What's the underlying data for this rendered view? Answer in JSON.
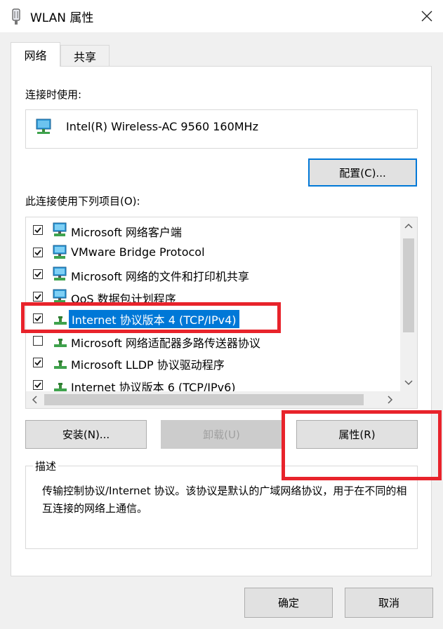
{
  "window": {
    "title": "WLAN 属性"
  },
  "tabs": [
    {
      "label": "网络"
    },
    {
      "label": "共享"
    }
  ],
  "connect_using": {
    "label": "连接时使用:",
    "adapter_name": "Intel(R) Wireless-AC 9560 160MHz",
    "configure_label": "配置(C)..."
  },
  "items_section": {
    "label": "此连接使用下列项目(O):",
    "items": [
      {
        "label": "Microsoft 网络客户端",
        "checked": true,
        "icon": "network-client-icon"
      },
      {
        "label": "VMware Bridge Protocol",
        "checked": true,
        "icon": "network-client-icon"
      },
      {
        "label": "Microsoft 网络的文件和打印机共享",
        "checked": true,
        "icon": "network-client-icon"
      },
      {
        "label": "QoS 数据包计划程序",
        "checked": true,
        "icon": "network-client-icon"
      },
      {
        "label": "Internet 协议版本 4 (TCP/IPv4)",
        "checked": true,
        "icon": "protocol-icon",
        "selected": true
      },
      {
        "label": "Microsoft 网络适配器多路传送器协议",
        "checked": false,
        "icon": "protocol-icon"
      },
      {
        "label": "Microsoft LLDP 协议驱动程序",
        "checked": true,
        "icon": "protocol-icon"
      },
      {
        "label": "Internet 协议版本 6 (TCP/IPv6)",
        "checked": true,
        "icon": "protocol-icon"
      }
    ]
  },
  "buttons": {
    "install": "安装(N)...",
    "uninstall": "卸载(U)",
    "properties": "属性(R)",
    "ok": "确定",
    "cancel": "取消"
  },
  "description": {
    "legend": "描述",
    "text": "传输控制协议/Internet 协议。该协议是默认的广域网络协议，用于在不同的相互连接的网络上通信。"
  },
  "colors": {
    "selection": "#0078d7",
    "highlight_box": "#e8232b"
  }
}
